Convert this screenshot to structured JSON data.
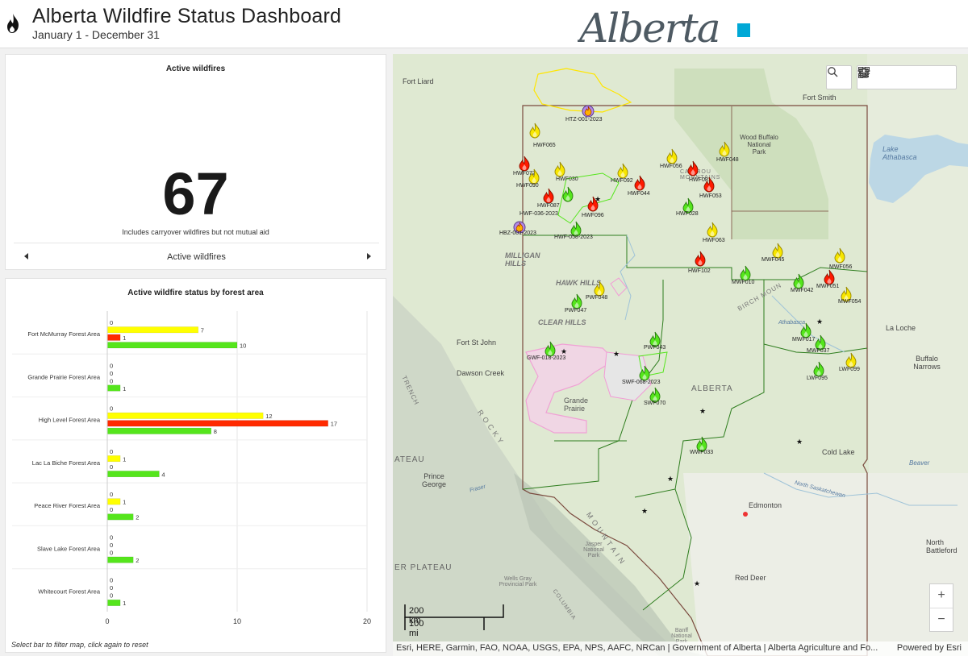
{
  "header": {
    "title": "Alberta Wildfire Status Dashboard",
    "subtitle": "January 1 - December 31",
    "logo_text": "Alberta"
  },
  "indicator": {
    "title": "Active wildfires",
    "value": "67",
    "note": "Includes carryover wildfires but not mutual aid",
    "pager_label": "Active wildfires"
  },
  "status_chart": {
    "title": "Active wildfire status by forest area",
    "note": "Select bar to filter map, click again to reset"
  },
  "colors": {
    "status_a": "#ffff00",
    "status_b": "#ff2a00",
    "status_c": "#55e51c",
    "boundary": "#7a4a3e",
    "forest_area": "#2e7d1e",
    "burn_pink": "#f29ad6"
  },
  "chart_data": {
    "type": "bar",
    "orientation": "horizontal",
    "categories": [
      "Fort McMurray Forest Area",
      "Grande Prairie Forest Area",
      "High Level Forest Area",
      "Lac La Biche Forest Area",
      "Peace River Forest Area",
      "Slave Lake Forest Area",
      "Whitecourt Forest Area"
    ],
    "series": [
      {
        "values": [
          0,
          0,
          0,
          0,
          0,
          0,
          0
        ],
        "color": "#999999"
      },
      {
        "values": [
          7,
          0,
          12,
          1,
          1,
          0,
          0
        ],
        "color": "#ffff00"
      },
      {
        "values": [
          1,
          0,
          17,
          0,
          0,
          0,
          0
        ],
        "color": "#ff2a00"
      },
      {
        "values": [
          10,
          1,
          8,
          4,
          2,
          2,
          1
        ],
        "color": "#55e51c"
      }
    ],
    "xlim": [
      0,
      20
    ],
    "xticks": [
      0,
      10,
      20
    ],
    "grid": true
  },
  "map": {
    "labels": [
      {
        "id": "fort-liard",
        "text": "Fort Liard"
      },
      {
        "id": "fort-smith",
        "text": "Fort Smith"
      },
      {
        "id": "wood-buffalo",
        "text": "Wood Buffalo National Park"
      },
      {
        "id": "lake-athabasca",
        "text": "Lake Athabasca"
      },
      {
        "id": "milligan-hills",
        "text": "MILLIGAN HILLS"
      },
      {
        "id": "hawk-hills",
        "text": "HAWK HILLS"
      },
      {
        "id": "clear-hills",
        "text": "CLEAR HILLS"
      },
      {
        "id": "fort-st-john",
        "text": "Fort St John"
      },
      {
        "id": "dawson-creek",
        "text": "Dawson Creek"
      },
      {
        "id": "alberta",
        "text": "ALBERTA"
      },
      {
        "id": "grande-prairie",
        "text": "Grande Prairie"
      },
      {
        "id": "la-loche",
        "text": "La Loche"
      },
      {
        "id": "buffalo-narrows",
        "text": "Buffalo Narrows"
      },
      {
        "id": "cold-lake",
        "text": "Cold Lake"
      },
      {
        "id": "beaver",
        "text": "Beaver"
      },
      {
        "id": "prince-george",
        "text": "Prince George"
      },
      {
        "id": "edmonton",
        "text": "Edmonton"
      },
      {
        "id": "north-battleford",
        "text": "North Battleford"
      },
      {
        "id": "red-deer",
        "text": "Red Deer"
      },
      {
        "id": "jasper",
        "text": "Jasper National Park"
      },
      {
        "id": "wells-gray",
        "text": "Wells Gray Provincial Park"
      },
      {
        "id": "banff",
        "text": "Banff National Park"
      },
      {
        "id": "plateau",
        "text": "ER PLATEAU"
      },
      {
        "id": "ateau",
        "text": "ATEAU"
      },
      {
        "id": "birch",
        "text": "BIRCH MOUN"
      },
      {
        "id": "trench",
        "text": "TRENCH"
      },
      {
        "id": "rocky",
        "text": "ROCKY"
      },
      {
        "id": "mountains",
        "text": "MOUNTAIN"
      },
      {
        "id": "fraser",
        "text": "Fraser"
      },
      {
        "id": "athabasca-river",
        "text": "Athabasca"
      },
      {
        "id": "north-sask",
        "text": "North Saskatchewan"
      },
      {
        "id": "columbia",
        "text": "COLUMBIA"
      },
      {
        "id": "caribou",
        "text": "CARIBOU MOUNTAINS"
      }
    ],
    "fires": [
      {
        "id": "HTZ-001-2023",
        "status": "purple"
      },
      {
        "id": "HWF065",
        "status": "yellow"
      },
      {
        "id": "HWF072",
        "status": "red"
      },
      {
        "id": "HWF030",
        "status": "yellow"
      },
      {
        "id": "HWF090",
        "status": "yellow"
      },
      {
        "id": "HWF087",
        "status": "red"
      },
      {
        "id": "HWF-036-2023",
        "status": "green"
      },
      {
        "id": "HBZ-001-2023",
        "status": "purple"
      },
      {
        "id": "HWF096",
        "status": "red"
      },
      {
        "id": "HWF-058-2023",
        "status": "green"
      },
      {
        "id": "HWF092",
        "status": "yellow"
      },
      {
        "id": "HWF044",
        "status": "red"
      },
      {
        "id": "HWF056",
        "status": "yellow"
      },
      {
        "id": "HWF081",
        "status": "red"
      },
      {
        "id": "HWF048",
        "status": "yellow"
      },
      {
        "id": "HWF053",
        "status": "red"
      },
      {
        "id": "HWF028",
        "status": "green"
      },
      {
        "id": "HWF063",
        "status": "yellow"
      },
      {
        "id": "HWF102",
        "status": "red"
      },
      {
        "id": "MWF010",
        "status": "green"
      },
      {
        "id": "MWF045",
        "status": "yellow"
      },
      {
        "id": "MWF056",
        "status": "yellow"
      },
      {
        "id": "MWF042",
        "status": "green"
      },
      {
        "id": "MWF051",
        "status": "red"
      },
      {
        "id": "MWF054",
        "status": "yellow"
      },
      {
        "id": "PWF048",
        "status": "yellow"
      },
      {
        "id": "PWF047",
        "status": "green"
      },
      {
        "id": "MWF017",
        "status": "green"
      },
      {
        "id": "MWF037",
        "status": "green"
      },
      {
        "id": "LWF095",
        "status": "green"
      },
      {
        "id": "LWF099",
        "status": "yellow"
      },
      {
        "id": "GWF-018-2023",
        "status": "green"
      },
      {
        "id": "PWF043",
        "status": "green"
      },
      {
        "id": "SWF-068-2023",
        "status": "green"
      },
      {
        "id": "SWF070",
        "status": "green"
      },
      {
        "id": "WWF033",
        "status": "green"
      }
    ],
    "scale": {
      "km": "200 km",
      "mi": "100 mi"
    },
    "attribution": "Esri, HERE, Garmin, FAO, NOAA, USGS, EPA, NPS, AAFC, NRCan | Government of Alberta | Alberta Agriculture and Fo...",
    "powered_by": "Powered by Esri",
    "tools": [
      "search-icon",
      "home-icon",
      "legend-icon",
      "layers-icon",
      "qr-code-icon"
    ],
    "zoom_in": "+",
    "zoom_out": "−"
  }
}
